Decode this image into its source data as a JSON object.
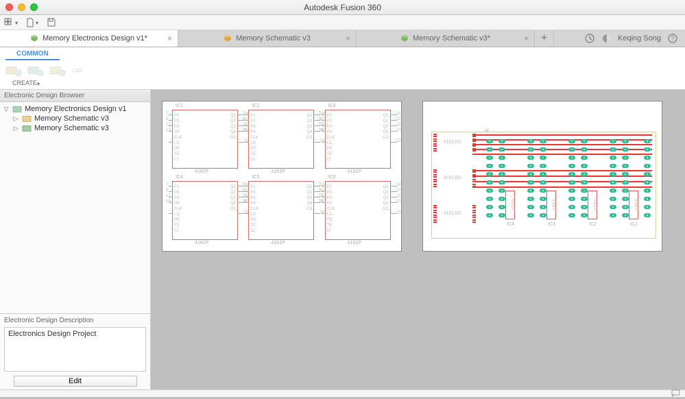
{
  "app_title": "Autodesk Fusion 360",
  "menu": {
    "grid": "⊞",
    "file": "📄",
    "save": "💾"
  },
  "tabs": [
    {
      "label": "Memory Electronics Design v1*",
      "active": true,
      "icon": "cube-green"
    },
    {
      "label": "Memory Schematic v3",
      "active": false,
      "icon": "cube-orange"
    },
    {
      "label": "Memory Schematic v3*",
      "active": false,
      "icon": "cube-green"
    }
  ],
  "header_icons": {
    "plus": "+",
    "extensions": "⏱",
    "notifications": "◐"
  },
  "user": {
    "name": "Keqing Song",
    "help": "?"
  },
  "ribbon": {
    "active_tab": "COMMON",
    "group": "CREATE"
  },
  "browser": {
    "title": "Electronic Design Browser",
    "root": "Memory Electronics Design v1",
    "children": [
      {
        "label": "Memory Schematic v3",
        "icon": "schematic"
      },
      {
        "label": "Memory Schematic v3",
        "icon": "board"
      }
    ],
    "description_title": "Electronic Design Description",
    "description_text": "Electronics Design Project",
    "edit_button": "Edit"
  },
  "schematic": {
    "ic_refs": [
      "IC1",
      "IC2",
      "IC3",
      "IC4",
      "IC5",
      "IC6"
    ],
    "ic_value": "4161P",
    "pins_left": [
      "P1",
      "P2",
      "P3",
      "P4",
      "",
      "CLK",
      "LD",
      "PE",
      "TE",
      "CI"
    ],
    "pins_right": [
      "Q1",
      "Q2",
      "Q3",
      "Q4",
      "",
      "CO"
    ],
    "nums_left": [
      "7",
      "9",
      "12",
      "14"
    ],
    "nums_right": [
      "14",
      "12",
      "11",
      "10",
      "",
      "15"
    ]
  },
  "pcb": {
    "so_label": "4161SO",
    "dip_label": "4161P",
    "refs": [
      "M",
      "IC4",
      "IC3",
      "IC2",
      "IC1"
    ]
  }
}
